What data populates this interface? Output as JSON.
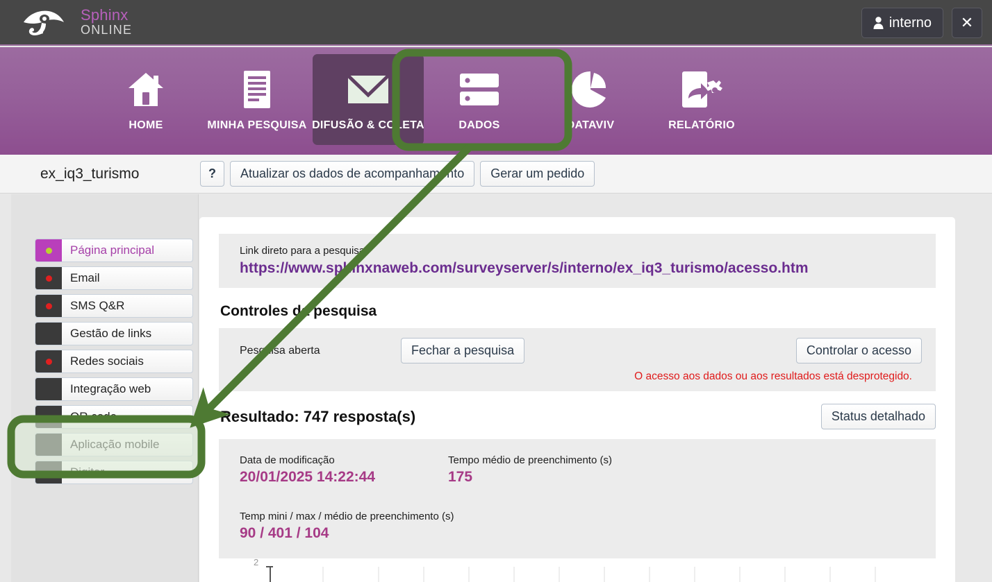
{
  "topbar": {
    "logo_name": "Sphinx",
    "logo_sub": "ONLINE",
    "user_label": "interno",
    "close_label": "✕"
  },
  "mainnav": {
    "items": [
      {
        "label": "HOME",
        "icon": "home-icon",
        "active": false
      },
      {
        "label": "MINHA PESQUISA",
        "icon": "document-icon",
        "active": false
      },
      {
        "label": "DIFUSÃO & COLETA",
        "icon": "envelope-icon",
        "active": true
      },
      {
        "label": "DADOS",
        "icon": "database-icon",
        "active": false
      },
      {
        "label": "DATAVIV",
        "icon": "pie-chart-icon",
        "active": false
      },
      {
        "label": "RELATÓRIO",
        "icon": "report-share-icon",
        "active": false
      }
    ]
  },
  "subheader": {
    "survey_name": "ex_iq3_turismo",
    "help_label": "?",
    "refresh_label": "Atualizar os dados de acompanhamento",
    "order_label": "Gerar um pedido"
  },
  "sidebar": {
    "items": [
      {
        "label": "Página principal",
        "dot": "green",
        "active": true
      },
      {
        "label": "Email",
        "dot": "red",
        "active": false
      },
      {
        "label": "SMS Q&R",
        "dot": "red",
        "active": false
      },
      {
        "label": "Gestão de links",
        "dot": "none",
        "active": false
      },
      {
        "label": "Redes sociais",
        "dot": "red",
        "active": false
      },
      {
        "label": "Integração web",
        "dot": "none",
        "active": false
      },
      {
        "label": "QR code",
        "dot": "none",
        "active": false
      },
      {
        "label": "Aplicação mobile",
        "dot": "none",
        "active": false
      },
      {
        "label": "Digitar",
        "dot": "none",
        "active": false
      }
    ]
  },
  "main": {
    "link_label": "Link direto para a pesquisa",
    "link_url": "https://www.sphinxnaweb.com/surveyserver/s/interno/ex_iq3_turismo/acesso.htm",
    "controls_title": "Controles da pesquisa",
    "survey_status": "Pesquisa aberta",
    "close_survey_label": "Fechar a pesquisa",
    "control_access_label": "Controlar o acesso",
    "warning": "O acesso aos dados ou aos resultados está desprotegido.",
    "result_title": "Resultado: 747 resposta(s)",
    "detailed_status_label": "Status detalhado",
    "stats": [
      {
        "label": "Data de modificação",
        "value": "20/01/2025 14:22:44"
      },
      {
        "label": "Tempo médio de preenchimento (s)",
        "value": "175"
      }
    ],
    "stat_wide": {
      "label": "Temp mini / max / médio de preenchimento (s)",
      "value": "90 / 401 / 104"
    },
    "chart_axis_top": "2"
  },
  "colors": {
    "brand_purple": "#96609a",
    "accent_magenta": "#a63a86",
    "link_purple": "#6b2d8f",
    "warning_red": "#e01b1b",
    "highlight_green": "#4e7a33"
  }
}
